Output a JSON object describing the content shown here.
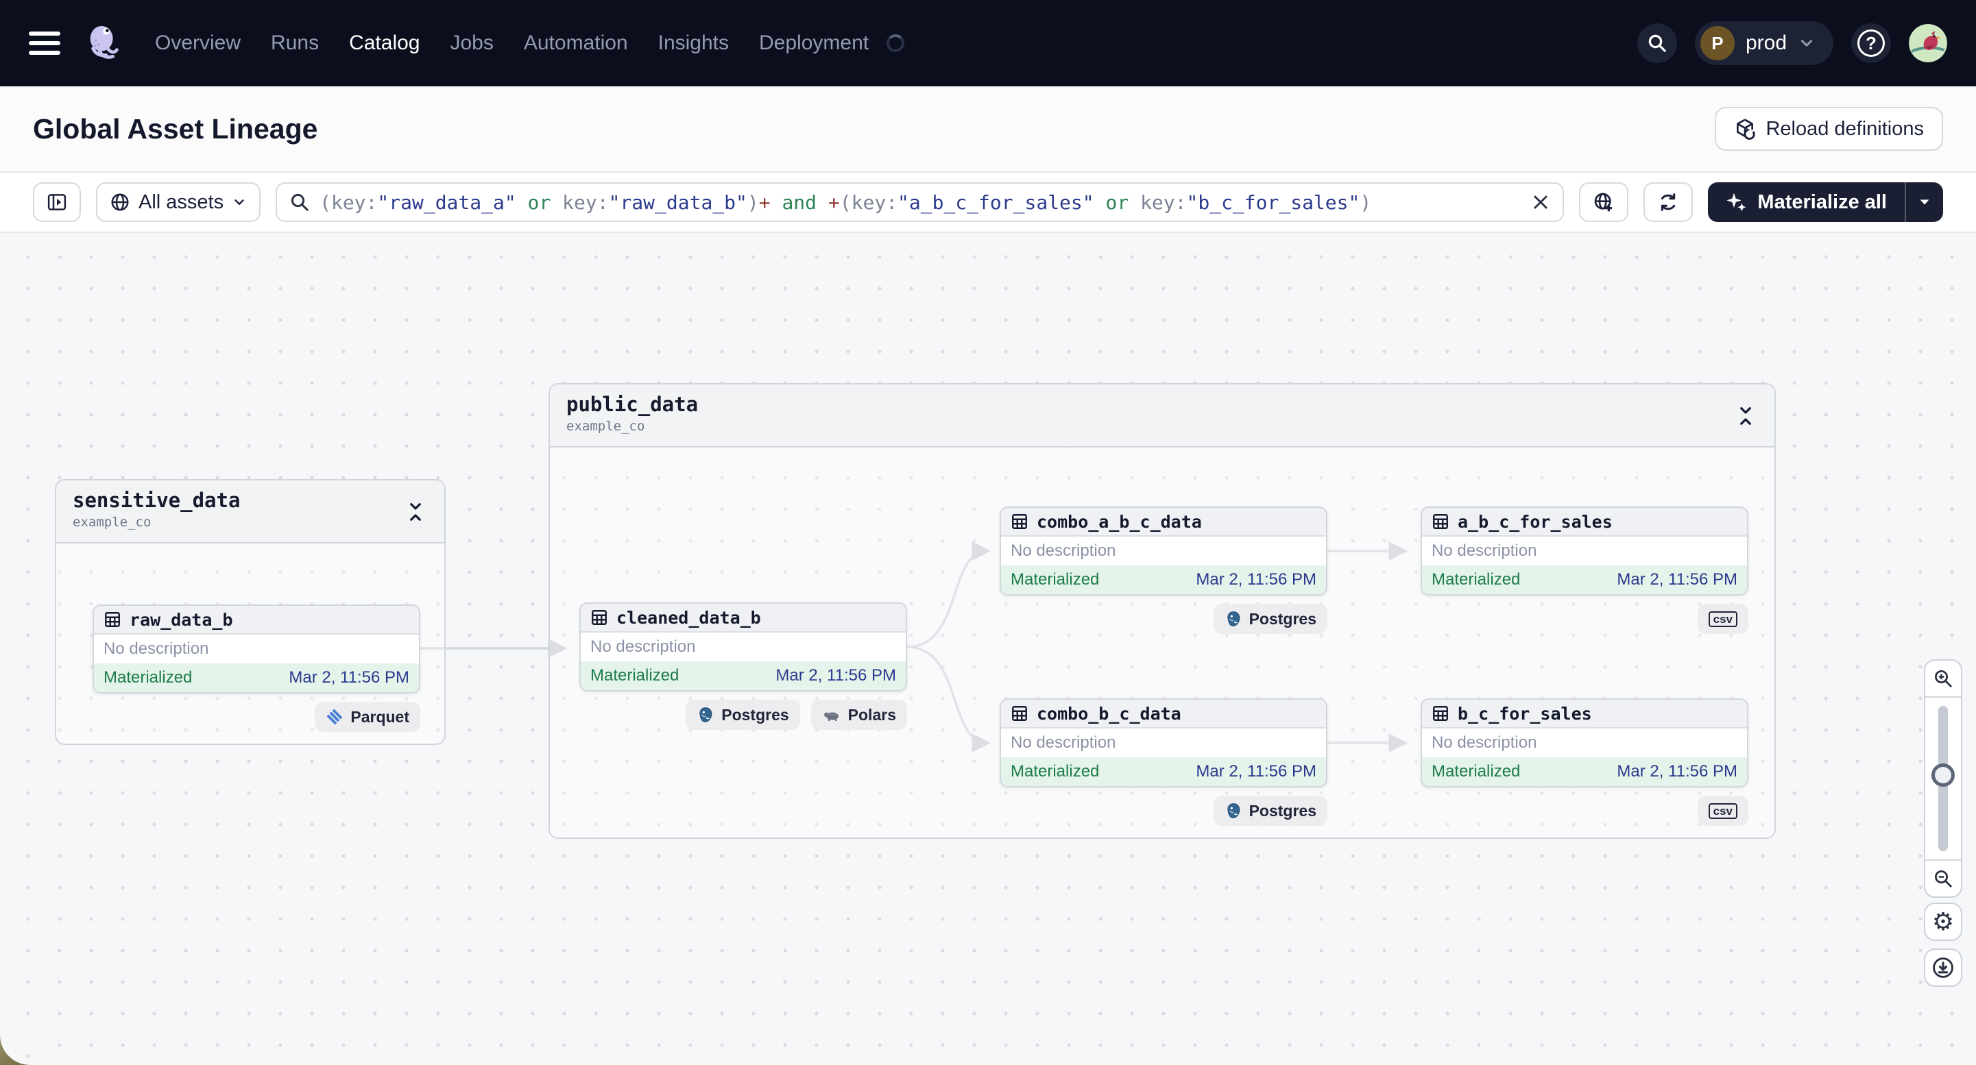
{
  "nav": {
    "items": [
      {
        "label": "Overview"
      },
      {
        "label": "Runs"
      },
      {
        "label": "Catalog",
        "active": true
      },
      {
        "label": "Jobs"
      },
      {
        "label": "Automation"
      },
      {
        "label": "Insights"
      },
      {
        "label": "Deployment"
      }
    ],
    "environment": {
      "initial": "P",
      "name": "prod"
    },
    "help_glyph": "?"
  },
  "header": {
    "title": "Global Asset Lineage",
    "reload_button_label": "Reload definitions"
  },
  "toolbar": {
    "scope_button_label": "All assets",
    "materialize_button_label": "Materialize all",
    "query_tokens": [
      {
        "text": "(key:",
        "kind": "plain"
      },
      {
        "text": "\"raw_data_a\"",
        "kind": "value"
      },
      {
        "text": " or ",
        "kind": "bool"
      },
      {
        "text": "key:",
        "kind": "plain"
      },
      {
        "text": "\"raw_data_b\"",
        "kind": "value"
      },
      {
        "text": ")",
        "kind": "plain"
      },
      {
        "text": "+",
        "kind": "plus"
      },
      {
        "text": " and ",
        "kind": "bool"
      },
      {
        "text": "+",
        "kind": "plus"
      },
      {
        "text": "(key:",
        "kind": "plain"
      },
      {
        "text": "\"a_b_c_for_sales\"",
        "kind": "value"
      },
      {
        "text": " or ",
        "kind": "bool"
      },
      {
        "text": "key:",
        "kind": "plain"
      },
      {
        "text": "\"b_c_for_sales\"",
        "kind": "value"
      },
      {
        "text": ")",
        "kind": "plain"
      }
    ]
  },
  "graph": {
    "groups": [
      {
        "title": "sensitive_data",
        "subtitle": "example_co"
      },
      {
        "title": "public_data",
        "subtitle": "example_co"
      }
    ],
    "nodes": [
      {
        "name": "raw_data_b",
        "description": "No description",
        "status": "Materialized",
        "timestamp": "Mar 2, 11:56 PM",
        "badges": [
          {
            "label": "Parquet",
            "icon": "parquet-icon"
          }
        ]
      },
      {
        "name": "cleaned_data_b",
        "description": "No description",
        "status": "Materialized",
        "timestamp": "Mar 2, 11:56 PM",
        "badges": [
          {
            "label": "Postgres",
            "icon": "postgres-icon"
          },
          {
            "label": "Polars",
            "icon": "polars-icon"
          }
        ]
      },
      {
        "name": "combo_a_b_c_data",
        "description": "No description",
        "status": "Materialized",
        "timestamp": "Mar 2, 11:56 PM",
        "badges": [
          {
            "label": "Postgres",
            "icon": "postgres-icon"
          }
        ]
      },
      {
        "name": "a_b_c_for_sales",
        "description": "No description",
        "status": "Materialized",
        "timestamp": "Mar 2, 11:56 PM",
        "badges": [
          {
            "label": "csv",
            "icon": "csv-icon"
          }
        ]
      },
      {
        "name": "combo_b_c_data",
        "description": "No description",
        "status": "Materialized",
        "timestamp": "Mar 2, 11:56 PM",
        "badges": [
          {
            "label": "Postgres",
            "icon": "postgres-icon"
          }
        ]
      },
      {
        "name": "b_c_for_sales",
        "description": "No description",
        "status": "Materialized",
        "timestamp": "Mar 2, 11:56 PM",
        "badges": [
          {
            "label": "csv",
            "icon": "csv-icon"
          }
        ]
      }
    ]
  },
  "colors": {
    "nav_background": "#0b0e1c",
    "materialized_green": "#1d7c49",
    "materialized_bg": "#e4f4ea",
    "timestamp_blue": "#2b3a8f",
    "query_value_blue": "#2c3a8c",
    "query_bool_green": "#2e8457",
    "query_plus_red": "#8c3b32",
    "edge_gray": "#d2d5da"
  },
  "icons": {
    "nav": [
      "menu-icon",
      "dagster-logo",
      "search-icon",
      "chevron-down-icon",
      "help-icon",
      "user-avatar"
    ],
    "toolbar": [
      "panel-toggle-icon",
      "globe-icon",
      "search-icon",
      "clear-icon",
      "globe-add-icon",
      "refresh-icon",
      "sparkles-icon",
      "caret-down-icon"
    ],
    "graph": [
      "table-icon",
      "collapse-vertical-icon",
      "parquet-icon",
      "postgres-icon",
      "polars-icon",
      "csv-icon"
    ],
    "controls": [
      "zoom-in-icon",
      "zoom-out-icon",
      "gear-icon",
      "download-icon"
    ]
  }
}
